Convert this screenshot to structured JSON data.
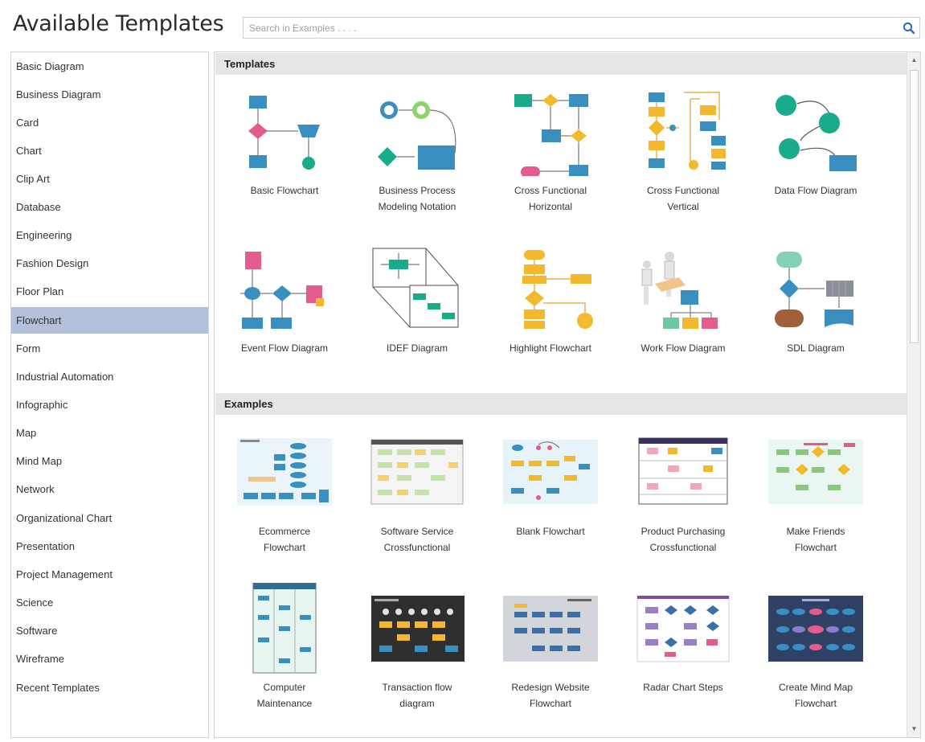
{
  "header": {
    "title": "Available Templates",
    "search_placeholder": "Search in Examples . . . ."
  },
  "sidebar": {
    "selected": "Flowchart",
    "items": [
      {
        "label": "Basic Diagram"
      },
      {
        "label": "Business Diagram"
      },
      {
        "label": "Card"
      },
      {
        "label": "Chart"
      },
      {
        "label": "Clip Art"
      },
      {
        "label": "Database"
      },
      {
        "label": "Engineering"
      },
      {
        "label": "Fashion Design"
      },
      {
        "label": "Floor Plan"
      },
      {
        "label": "Flowchart"
      },
      {
        "label": "Form"
      },
      {
        "label": "Industrial Automation"
      },
      {
        "label": "Infographic"
      },
      {
        "label": "Map"
      },
      {
        "label": "Mind Map"
      },
      {
        "label": "Network"
      },
      {
        "label": "Organizational Chart"
      },
      {
        "label": "Presentation"
      },
      {
        "label": "Project Management"
      },
      {
        "label": "Science"
      },
      {
        "label": "Software"
      },
      {
        "label": "Wireframe"
      },
      {
        "label": "Recent Templates"
      }
    ]
  },
  "templates": {
    "header": "Templates",
    "items": [
      {
        "line1": "Basic Flowchart",
        "line2": "",
        "icon": "basic-flowchart-icon"
      },
      {
        "line1": "Business Process",
        "line2": "Modeling Notation",
        "icon": "bpmn-icon"
      },
      {
        "line1": "Cross Functional",
        "line2": "Horizontal",
        "icon": "cross-functional-horizontal-icon"
      },
      {
        "line1": "Cross Functional",
        "line2": "Vertical",
        "icon": "cross-functional-vertical-icon"
      },
      {
        "line1": "Data Flow Diagram",
        "line2": "",
        "icon": "data-flow-diagram-icon"
      },
      {
        "line1": "Event Flow Diagram",
        "line2": "",
        "icon": "event-flow-diagram-icon"
      },
      {
        "line1": "IDEF Diagram",
        "line2": "",
        "icon": "idef-diagram-icon"
      },
      {
        "line1": "Highlight Flowchart",
        "line2": "",
        "icon": "highlight-flowchart-icon"
      },
      {
        "line1": "Work Flow Diagram",
        "line2": "",
        "icon": "work-flow-diagram-icon"
      },
      {
        "line1": "SDL Diagram",
        "line2": "",
        "icon": "sdl-diagram-icon"
      }
    ]
  },
  "examples": {
    "header": "Examples",
    "items": [
      {
        "line1": "Ecommerce",
        "line2": "Flowchart"
      },
      {
        "line1": "Software Service",
        "line2": "Crossfunctional"
      },
      {
        "line1": "Blank Flowchart",
        "line2": ""
      },
      {
        "line1": "Product Purchasing",
        "line2": "Crossfunctional"
      },
      {
        "line1": "Make Friends",
        "line2": "Flowchart"
      },
      {
        "line1": "Computer",
        "line2": "Maintenance"
      },
      {
        "line1": "Transaction flow",
        "line2": "diagram"
      },
      {
        "line1": "Redesign Website",
        "line2": "Flowchart"
      },
      {
        "line1": "Radar Chart Steps",
        "line2": ""
      },
      {
        "line1": "Create Mind Map",
        "line2": "Flowchart"
      }
    ]
  },
  "colors": {
    "accent_blue": "#3a8fc1",
    "pink": "#e25d8e",
    "teal": "#1aab8a",
    "yellow": "#f3b92e",
    "selected_bg": "#b4c0da",
    "section_bg": "#e6e6e6"
  }
}
